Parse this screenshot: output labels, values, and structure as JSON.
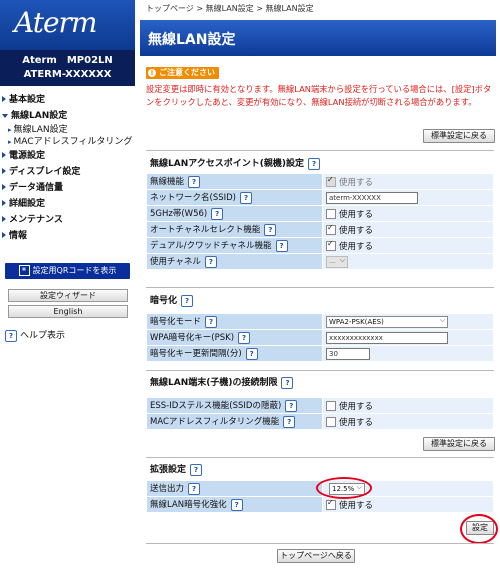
{
  "sidebar": {
    "logo": "Aterm",
    "model_line1": "Aterm　MP02LN",
    "model_line2": "ATERM-XXXXXX",
    "items": [
      {
        "label": "基本設定"
      },
      {
        "label": "無線LAN設定"
      },
      {
        "label": "電源設定"
      },
      {
        "label": "ディスプレイ設定"
      },
      {
        "label": "データ通信量"
      },
      {
        "label": "詳細設定"
      },
      {
        "label": "メンテナンス"
      },
      {
        "label": "情報"
      }
    ],
    "subitems": [
      {
        "label": "無線LAN設定"
      },
      {
        "label": "MACアドレスフィルタリング"
      }
    ],
    "qr_button": "設定用QRコードを表示",
    "wizard_button": "設定ウィザード",
    "english_button": "English",
    "help_label": "ヘルプ表示"
  },
  "breadcrumb": "トップページ > 無線LAN設定 > 無線LAN設定",
  "page_title": "無線LAN設定",
  "caution": {
    "badge": "ご注意ください",
    "text": "設定変更は即時に有効となります。無線LAN端末から設定を行っている場合には、[設定]ボタンをクリックしたあと、変更が有効になり、無線LAN接続が切断される場合があります。"
  },
  "reset_label": "標準設定に戻る",
  "ap_section": {
    "title": "無線LANアクセスポイント(親機)設定",
    "rows": [
      {
        "label": "無線機能",
        "value": "使用する"
      },
      {
        "label": "ネットワーク名(SSID)",
        "value": "aterm-XXXXXX"
      },
      {
        "label": "5GHz帯(W56)",
        "value": "使用する"
      },
      {
        "label": "オートチャネルセレクト機能",
        "value": "使用する"
      },
      {
        "label": "デュアル/クワッドチャネル機能",
        "value": "使用する"
      },
      {
        "label": "使用チャネル",
        "value": "—"
      }
    ]
  },
  "crypto_section": {
    "title": "暗号化",
    "rows": [
      {
        "label": "暗号化モード",
        "value": "WPA2-PSK(AES)"
      },
      {
        "label": "WPA暗号化キー(PSK)",
        "value": "xxxxxxxxxxxxx"
      },
      {
        "label": "暗号化キー更新間隔(分)",
        "value": "30"
      }
    ]
  },
  "limit_section": {
    "title": "無線LAN端末(子機)の接続制限",
    "rows": [
      {
        "label": "ESS-IDステルス機能(SSIDの隠蔽)",
        "value": "使用する"
      },
      {
        "label": "MACアドレスフィルタリング機能",
        "value": "使用する"
      }
    ]
  },
  "ext_section": {
    "title": "拡張設定",
    "rows": [
      {
        "label": "送信出力",
        "value": "12.5%"
      },
      {
        "label": "無線LAN暗号化強化",
        "value": "使用する"
      }
    ]
  },
  "apply_label": "設定",
  "top_label": "トップページへ戻る",
  "colors": {
    "accent": "#0c3a96",
    "warning": "#e0201c",
    "highlight": "#e4001b"
  }
}
